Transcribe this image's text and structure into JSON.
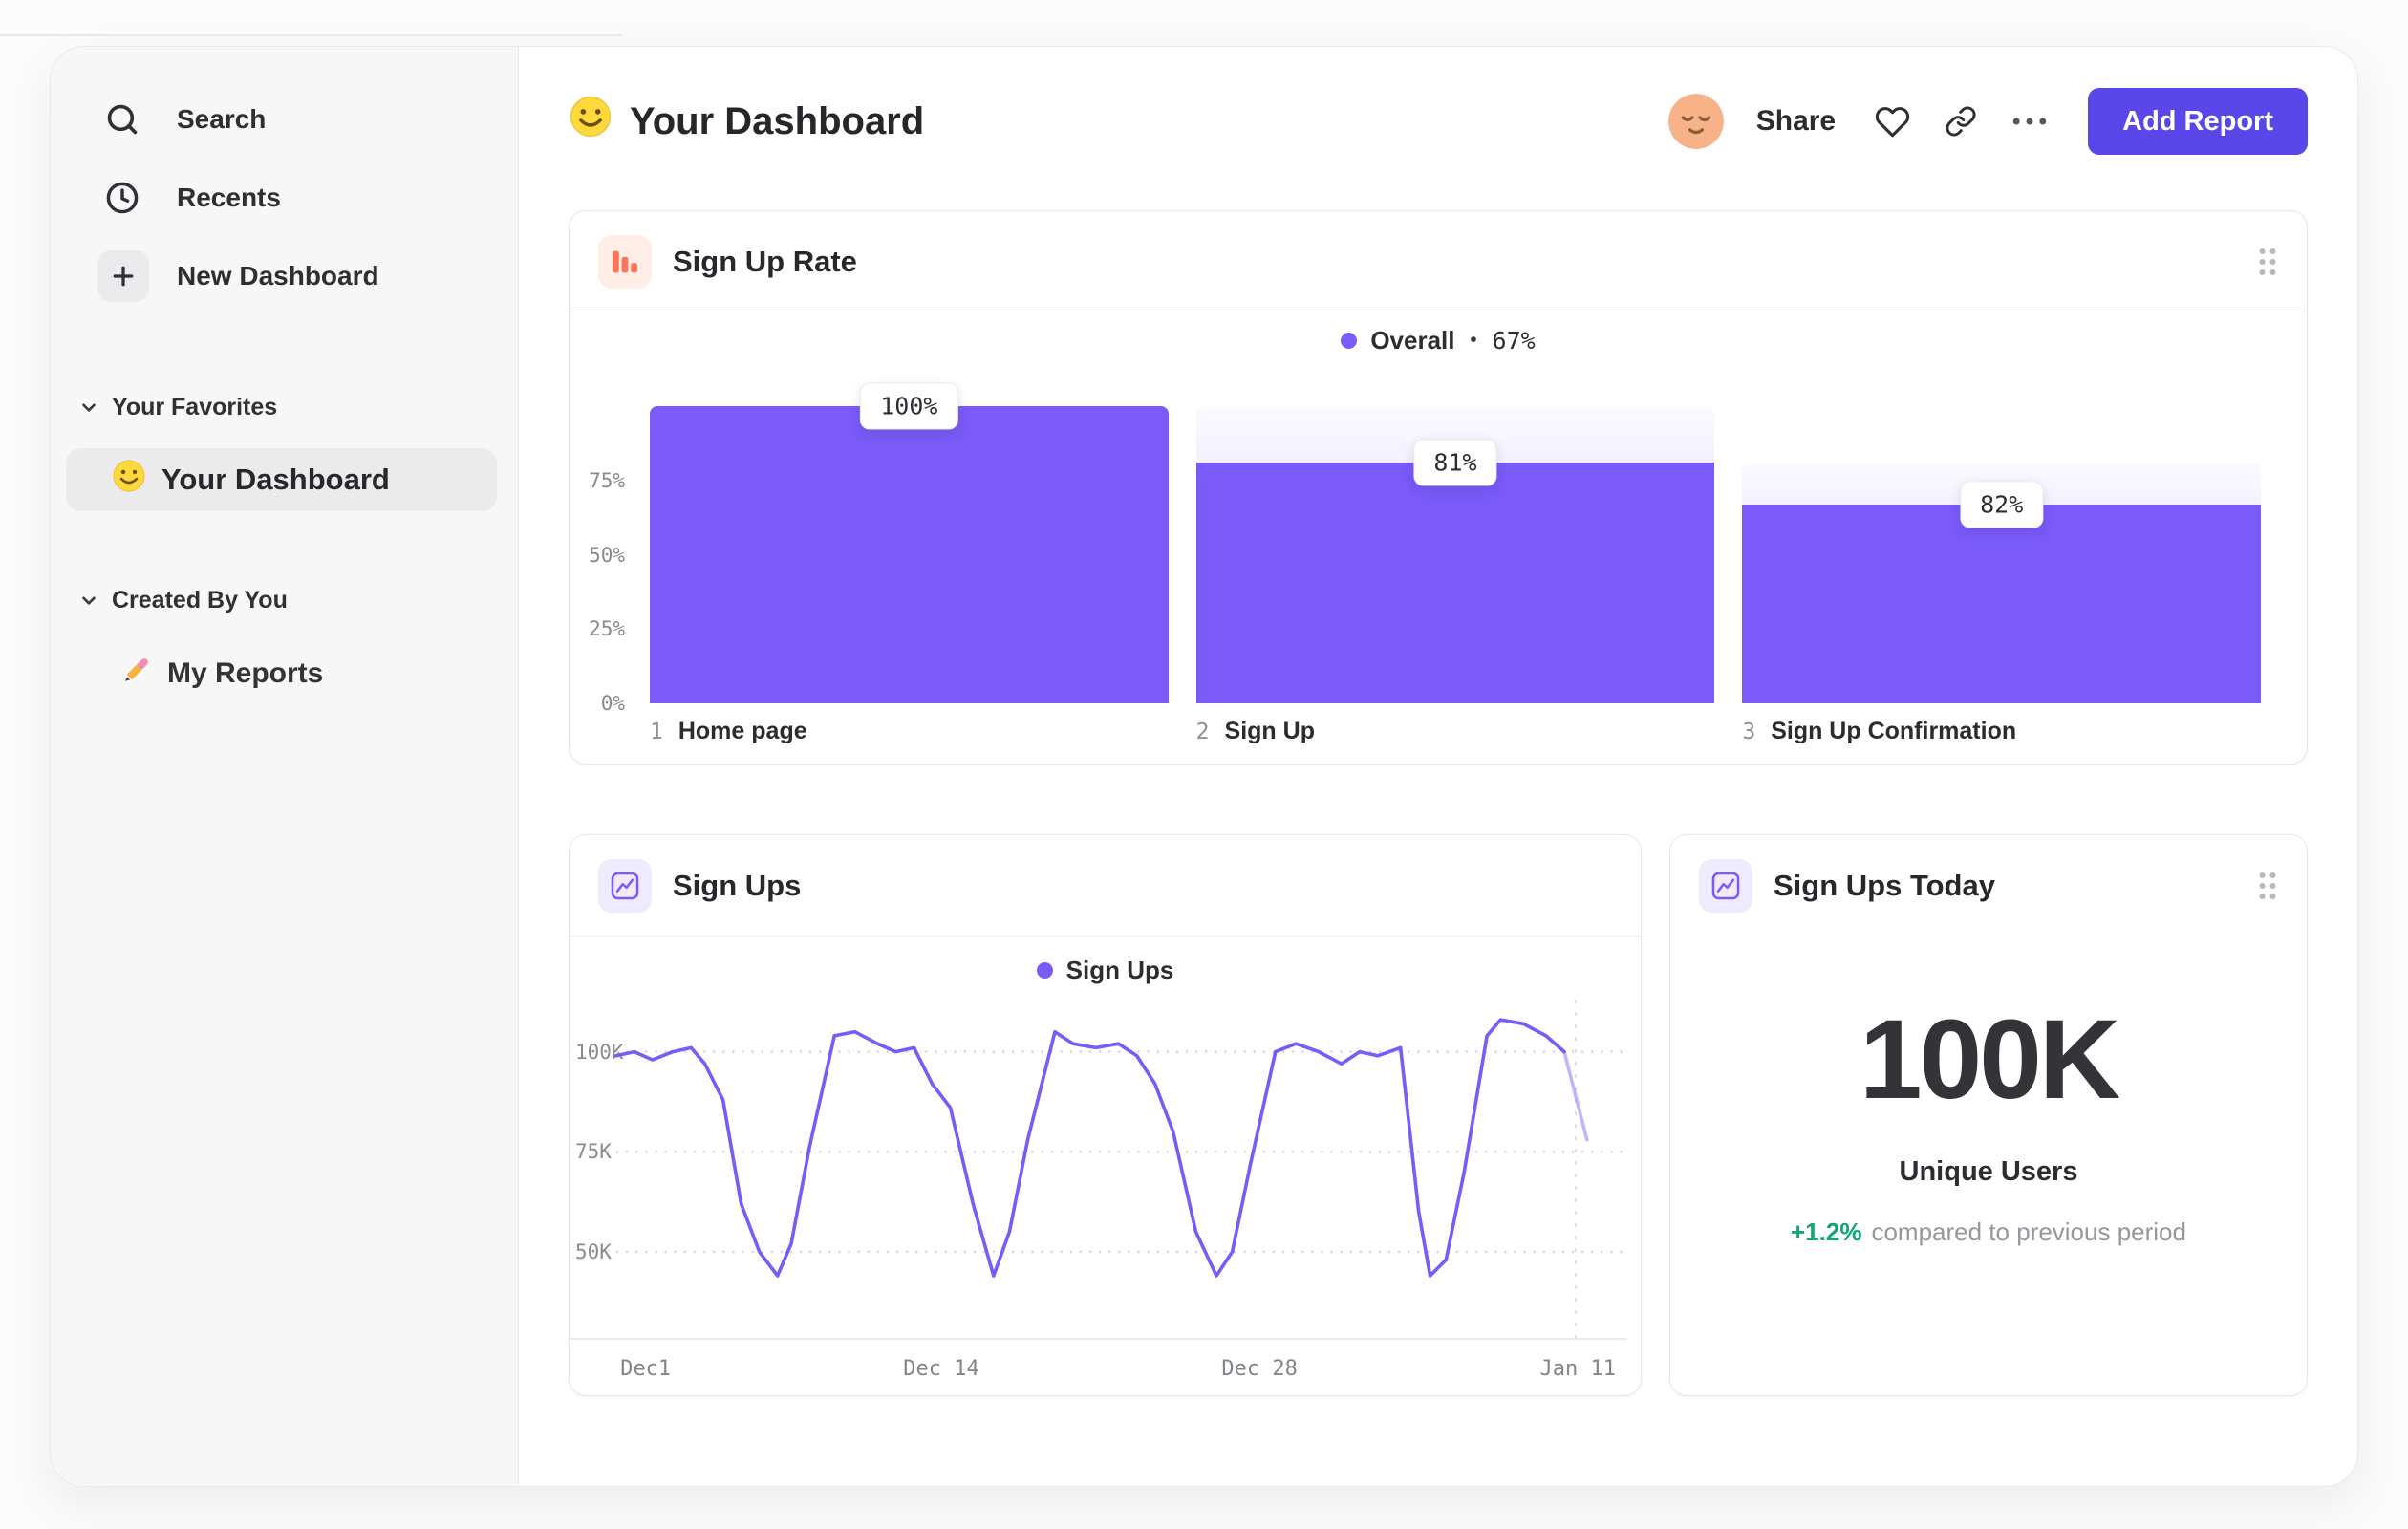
{
  "app": {
    "header": {
      "title": "Your Dashboard",
      "share_label": "Share",
      "add_report_label": "Add Report"
    }
  },
  "sidebar": {
    "nav": [
      {
        "label": "Search",
        "icon": "search-icon"
      },
      {
        "label": "Recents",
        "icon": "clock-icon"
      },
      {
        "label": "New Dashboard",
        "icon": "plus-icon"
      }
    ],
    "sections": [
      {
        "label": "Your Favorites",
        "items": [
          {
            "label": "Your Dashboard",
            "icon": "smiley-emoji",
            "selected": true
          }
        ]
      },
      {
        "label": "Created By You",
        "items": [
          {
            "label": "My Reports",
            "icon": "pencil-emoji",
            "selected": false
          }
        ]
      }
    ]
  },
  "cards": {
    "funnel": {
      "title": "Sign Up Rate",
      "legend_series": "Overall",
      "legend_separator": "•",
      "legend_value": "67%"
    },
    "line": {
      "title": "Sign Ups",
      "legend_series": "Sign Ups"
    },
    "big": {
      "title": "Sign Ups Today",
      "value": "100K",
      "label": "Unique Users",
      "delta": "+1.2%",
      "delta_note": "compared to previous period"
    }
  },
  "colors": {
    "accent": "#7a5af8",
    "button": "#5a47ea",
    "funnel_icon": "#ff7557",
    "positive": "#0fa673"
  },
  "chart_data": [
    {
      "type": "bar",
      "subtype": "funnel",
      "title": "Sign Up Rate",
      "legend": [
        {
          "label": "Overall",
          "value": "67%"
        }
      ],
      "categories": [
        "Home page",
        "Sign Up",
        "Sign Up Confirmation"
      ],
      "steps": [
        {
          "index": "1",
          "label": "Home page",
          "badge": "100%",
          "overall_pct": 100,
          "step_conversion_pct": 100
        },
        {
          "index": "2",
          "label": "Sign Up",
          "badge": "81%",
          "overall_pct": 81,
          "step_conversion_pct": 81
        },
        {
          "index": "3",
          "label": "Sign Up Confirmation",
          "badge": "82%",
          "overall_pct": 67,
          "step_conversion_pct": 82
        }
      ],
      "y_ticks": [
        {
          "pct": 75,
          "label": "75%"
        },
        {
          "pct": 50,
          "label": "50%"
        },
        {
          "pct": 25,
          "label": "25%"
        },
        {
          "pct": 0,
          "label": "0%"
        }
      ],
      "ylim": [
        0,
        100
      ],
      "grid": false,
      "legend_position": "top-center"
    },
    {
      "type": "line",
      "title": "Sign Ups",
      "legend": [
        "Sign Ups"
      ],
      "x_axis": {
        "unit": "days_since_dec1",
        "ticks": [
          {
            "day": 0,
            "label": "Dec1"
          },
          {
            "day": 13,
            "label": "Dec 14"
          },
          {
            "day": 27,
            "label": "Dec 28"
          },
          {
            "day": 41,
            "label": "Jan 11"
          }
        ],
        "xlim": [
          -1.5,
          42.5
        ]
      },
      "y_axis": {
        "unit": "signups_thousands",
        "ticks": [
          {
            "value": 100,
            "label": "100K"
          },
          {
            "value": 75,
            "label": "75K"
          },
          {
            "value": 50,
            "label": "50K"
          }
        ],
        "ylim": [
          28,
          114
        ]
      },
      "grid": "dotted-horizontal",
      "legend_position": "top-center",
      "series": [
        {
          "name": "Sign Ups",
          "points": [
            [
              -1.3,
              99
            ],
            [
              -0.5,
              100
            ],
            [
              0.3,
              98
            ],
            [
              1.2,
              100
            ],
            [
              2,
              101
            ],
            [
              2.6,
              97
            ],
            [
              3.4,
              88
            ],
            [
              4.2,
              62
            ],
            [
              5,
              50
            ],
            [
              5.8,
              44
            ],
            [
              6.4,
              52
            ],
            [
              7.2,
              76
            ],
            [
              8.3,
              104
            ],
            [
              9.2,
              105
            ],
            [
              10.2,
              102
            ],
            [
              11,
              100
            ],
            [
              11.8,
              101
            ],
            [
              12.6,
              92
            ],
            [
              13.4,
              86
            ],
            [
              14.4,
              62
            ],
            [
              15.3,
              44
            ],
            [
              16,
              55
            ],
            [
              16.8,
              78
            ],
            [
              18,
              105
            ],
            [
              18.8,
              102
            ],
            [
              19.8,
              101
            ],
            [
              20.8,
              102
            ],
            [
              21.6,
              99
            ],
            [
              22.4,
              92
            ],
            [
              23.2,
              80
            ],
            [
              24.2,
              55
            ],
            [
              25.1,
              44
            ],
            [
              25.8,
              50
            ],
            [
              26.6,
              72
            ],
            [
              27.7,
              100
            ],
            [
              28.6,
              102
            ],
            [
              29.6,
              100
            ],
            [
              30.6,
              97
            ],
            [
              31.4,
              100
            ],
            [
              32.2,
              99
            ],
            [
              33.2,
              101
            ],
            [
              34,
              60
            ],
            [
              34.5,
              44
            ],
            [
              35.2,
              48
            ],
            [
              36,
              70
            ],
            [
              37,
              104
            ],
            [
              37.6,
              108
            ],
            [
              38.6,
              107
            ],
            [
              39.6,
              104
            ],
            [
              40.4,
              100
            ]
          ]
        }
      ],
      "incomplete_tail": [
        [
          40.4,
          100
        ],
        [
          41.4,
          78
        ]
      ]
    },
    {
      "type": "big-number",
      "title": "Sign Ups Today",
      "value": "100K",
      "label": "Unique Users",
      "delta_pct": "+1.2%",
      "delta_note": "compared to previous period"
    }
  ]
}
